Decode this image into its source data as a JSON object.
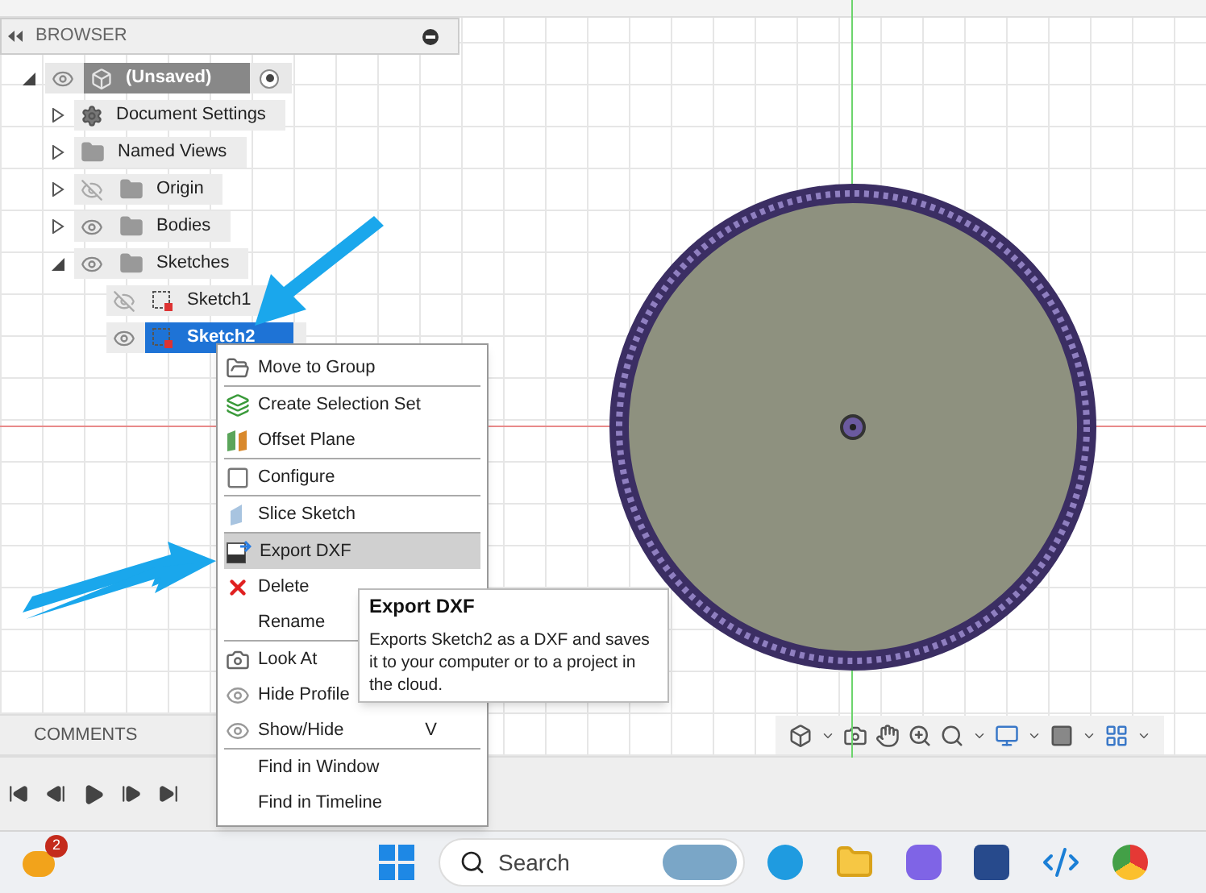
{
  "browser": {
    "title": "BROWSER",
    "items": [
      {
        "label": "(Unsaved)",
        "kind": "component",
        "expanded": true,
        "visible": true,
        "children": [
          {
            "label": "Document Settings",
            "kind": "settings",
            "expanded": false
          },
          {
            "label": "Named Views",
            "kind": "folder",
            "expanded": false
          },
          {
            "label": "Origin",
            "kind": "folder",
            "expanded": false,
            "visible": false
          },
          {
            "label": "Bodies",
            "kind": "folder",
            "expanded": false,
            "visible": true
          },
          {
            "label": "Sketches",
            "kind": "folder",
            "expanded": true,
            "visible": true,
            "children": [
              {
                "label": "Sketch1",
                "kind": "sketch",
                "visible": false,
                "selected": false
              },
              {
                "label": "Sketch2",
                "kind": "sketch",
                "visible": true,
                "selected": true
              }
            ]
          }
        ]
      }
    ]
  },
  "context_menu": {
    "groups": [
      [
        {
          "label": "Move to Group",
          "kind": "move",
          "highlighted": false
        }
      ],
      [
        {
          "label": "Create Selection Set",
          "kind": "selection",
          "highlighted": false
        },
        {
          "label": "Offset Plane",
          "kind": "plane",
          "highlighted": false
        }
      ],
      [
        {
          "label": "Configure",
          "kind": "configure",
          "highlighted": false
        }
      ],
      [
        {
          "label": "Slice Sketch",
          "kind": "slice",
          "highlighted": false
        }
      ],
      [
        {
          "label": "Export DXF",
          "kind": "export",
          "highlighted": true
        },
        {
          "label": "Delete",
          "kind": "delete",
          "highlighted": false
        },
        {
          "label": "Rename",
          "kind": "plain",
          "highlighted": false
        }
      ],
      [
        {
          "label": "Look At",
          "kind": "look",
          "highlighted": false
        },
        {
          "label": "Hide Profile",
          "kind": "visibility",
          "highlighted": false
        },
        {
          "label": "Show/Hide",
          "kind": "visibility",
          "shortcut": "V",
          "highlighted": false
        }
      ],
      [
        {
          "label": "Find in Window",
          "kind": "plain",
          "highlighted": false
        },
        {
          "label": "Find in Timeline",
          "kind": "plain",
          "highlighted": false
        }
      ]
    ]
  },
  "tooltip": {
    "title": "Export DXF",
    "body": "Exports Sketch2 as a DXF and saves it to your computer or to a project in the cloud."
  },
  "comments": {
    "title": "COMMENTS"
  },
  "taskbar": {
    "search_placeholder": "Search",
    "weather_badge": "2"
  }
}
